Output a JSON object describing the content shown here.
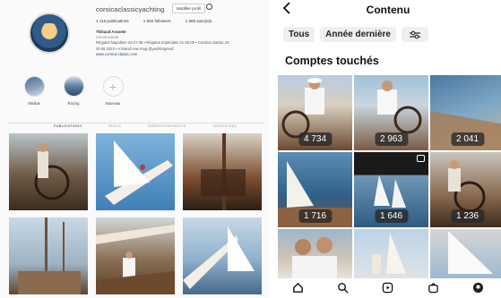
{
  "left": {
    "username": "corsicaclassicyachting",
    "edit_profile": "Modifier profil",
    "stats": [
      "1 116 publications",
      "1 894 followers",
      "1 585 suivi(e)s"
    ],
    "bio": {
      "name": "Thibaud Assante",
      "category": "Communauté",
      "line1": "Régates Napoléon 23-27.09 • Régates Impériales 21-25.09 • Corsica Classic 22-",
      "line2": "30.08.2023 • A brand new mag @yachtingmed",
      "link": "www.corsica-classic.com"
    },
    "highlights": [
      "Médias",
      "Racing",
      "Nouveau"
    ],
    "tabs": [
      "PUBLICATIONS",
      "REELS",
      "ENREGISTREMENTS",
      "IDENTIFIÉ(E)"
    ]
  },
  "right": {
    "title": "Contenu",
    "filters": [
      "Tous",
      "Année dernière"
    ],
    "section_title": "Comptes touchés",
    "counts": [
      "4 734",
      "2 963",
      "2 041",
      "1 716",
      "1 646",
      "1 236"
    ]
  },
  "icons": {
    "back": "chevron-left-icon",
    "filter": "sliders-icon",
    "nav": [
      "home-icon",
      "search-icon",
      "reels-icon",
      "shop-icon",
      "profile-icon"
    ]
  }
}
